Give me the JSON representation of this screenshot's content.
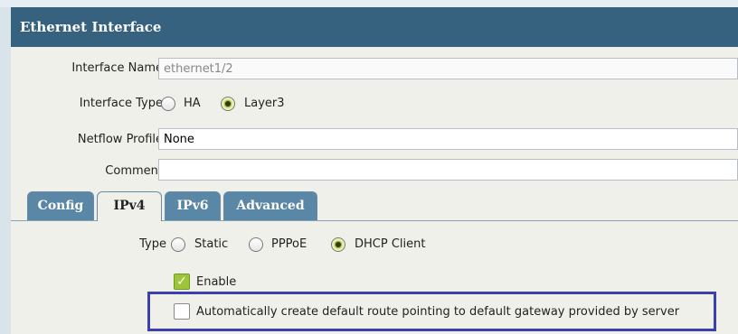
{
  "dialog": {
    "title": "Ethernet Interface"
  },
  "form": {
    "interface_name": {
      "label": "Interface Name",
      "value": "ethernet1/2"
    },
    "interface_type": {
      "label": "Interface Type",
      "options": [
        "HA",
        "Layer3"
      ],
      "selected": "Layer3"
    },
    "netflow_profile": {
      "label": "Netflow Profile",
      "value": "None"
    },
    "comment": {
      "label": "Comment",
      "value": ""
    }
  },
  "tabs": [
    {
      "label": "Config",
      "active": false
    },
    {
      "label": "IPv4",
      "active": true
    },
    {
      "label": "IPv6",
      "active": false
    },
    {
      "label": "Advanced",
      "active": false
    }
  ],
  "ipv4": {
    "type_label": "Type",
    "type_options": [
      "Static",
      "PPPoE",
      "DHCP Client"
    ],
    "type_selected": "DHCP Client",
    "enable_label": "Enable",
    "enable_checked": true,
    "auto_route_label": "Automatically create default route pointing to default gateway provided by server",
    "auto_route_checked": false
  },
  "colors": {
    "titlebar": "#36627f",
    "tab": "#5b87a6",
    "highlight_border": "#3c3fb0",
    "checkbox_on": "#9ec43a"
  }
}
